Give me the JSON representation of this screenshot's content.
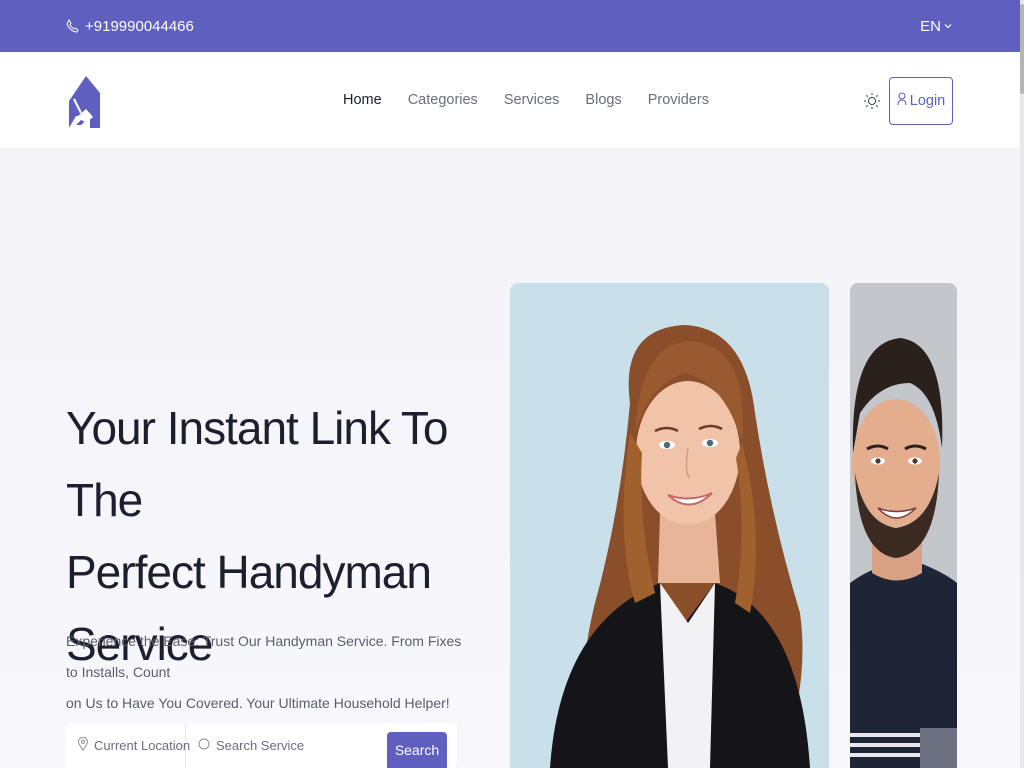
{
  "topbar": {
    "phone": "+919990044466",
    "language": "EN",
    "bg_color": "#5f5fbf"
  },
  "navbar": {
    "logo": "handyman-logo",
    "links": [
      "Home",
      "Categories",
      "Services",
      "Blogs",
      "Providers"
    ],
    "active_link": "Home",
    "theme_icon": "sun-icon",
    "login_label": "Login"
  },
  "hero": {
    "title_lines": [
      "Your Instant Link To The",
      "Perfect Handyman",
      "Service"
    ],
    "description_lines": [
      "Experience the Ease: Trust Our Handyman Service. From Fixes to Installs, Count",
      "on Us to Have You Covered. Your Ultimate Household Helper!"
    ],
    "search": {
      "location_placeholder": "Current Location",
      "service_placeholder": "Search Service",
      "button_label": "Search"
    },
    "images": {
      "woman_card_bg": "#c9e0ea",
      "man_card_bg": "#c3c6cb"
    }
  },
  "colors": {
    "accent": "#5f5fbf",
    "text_dark": "#1c1f2e",
    "text_muted": "#6b6e7c"
  }
}
